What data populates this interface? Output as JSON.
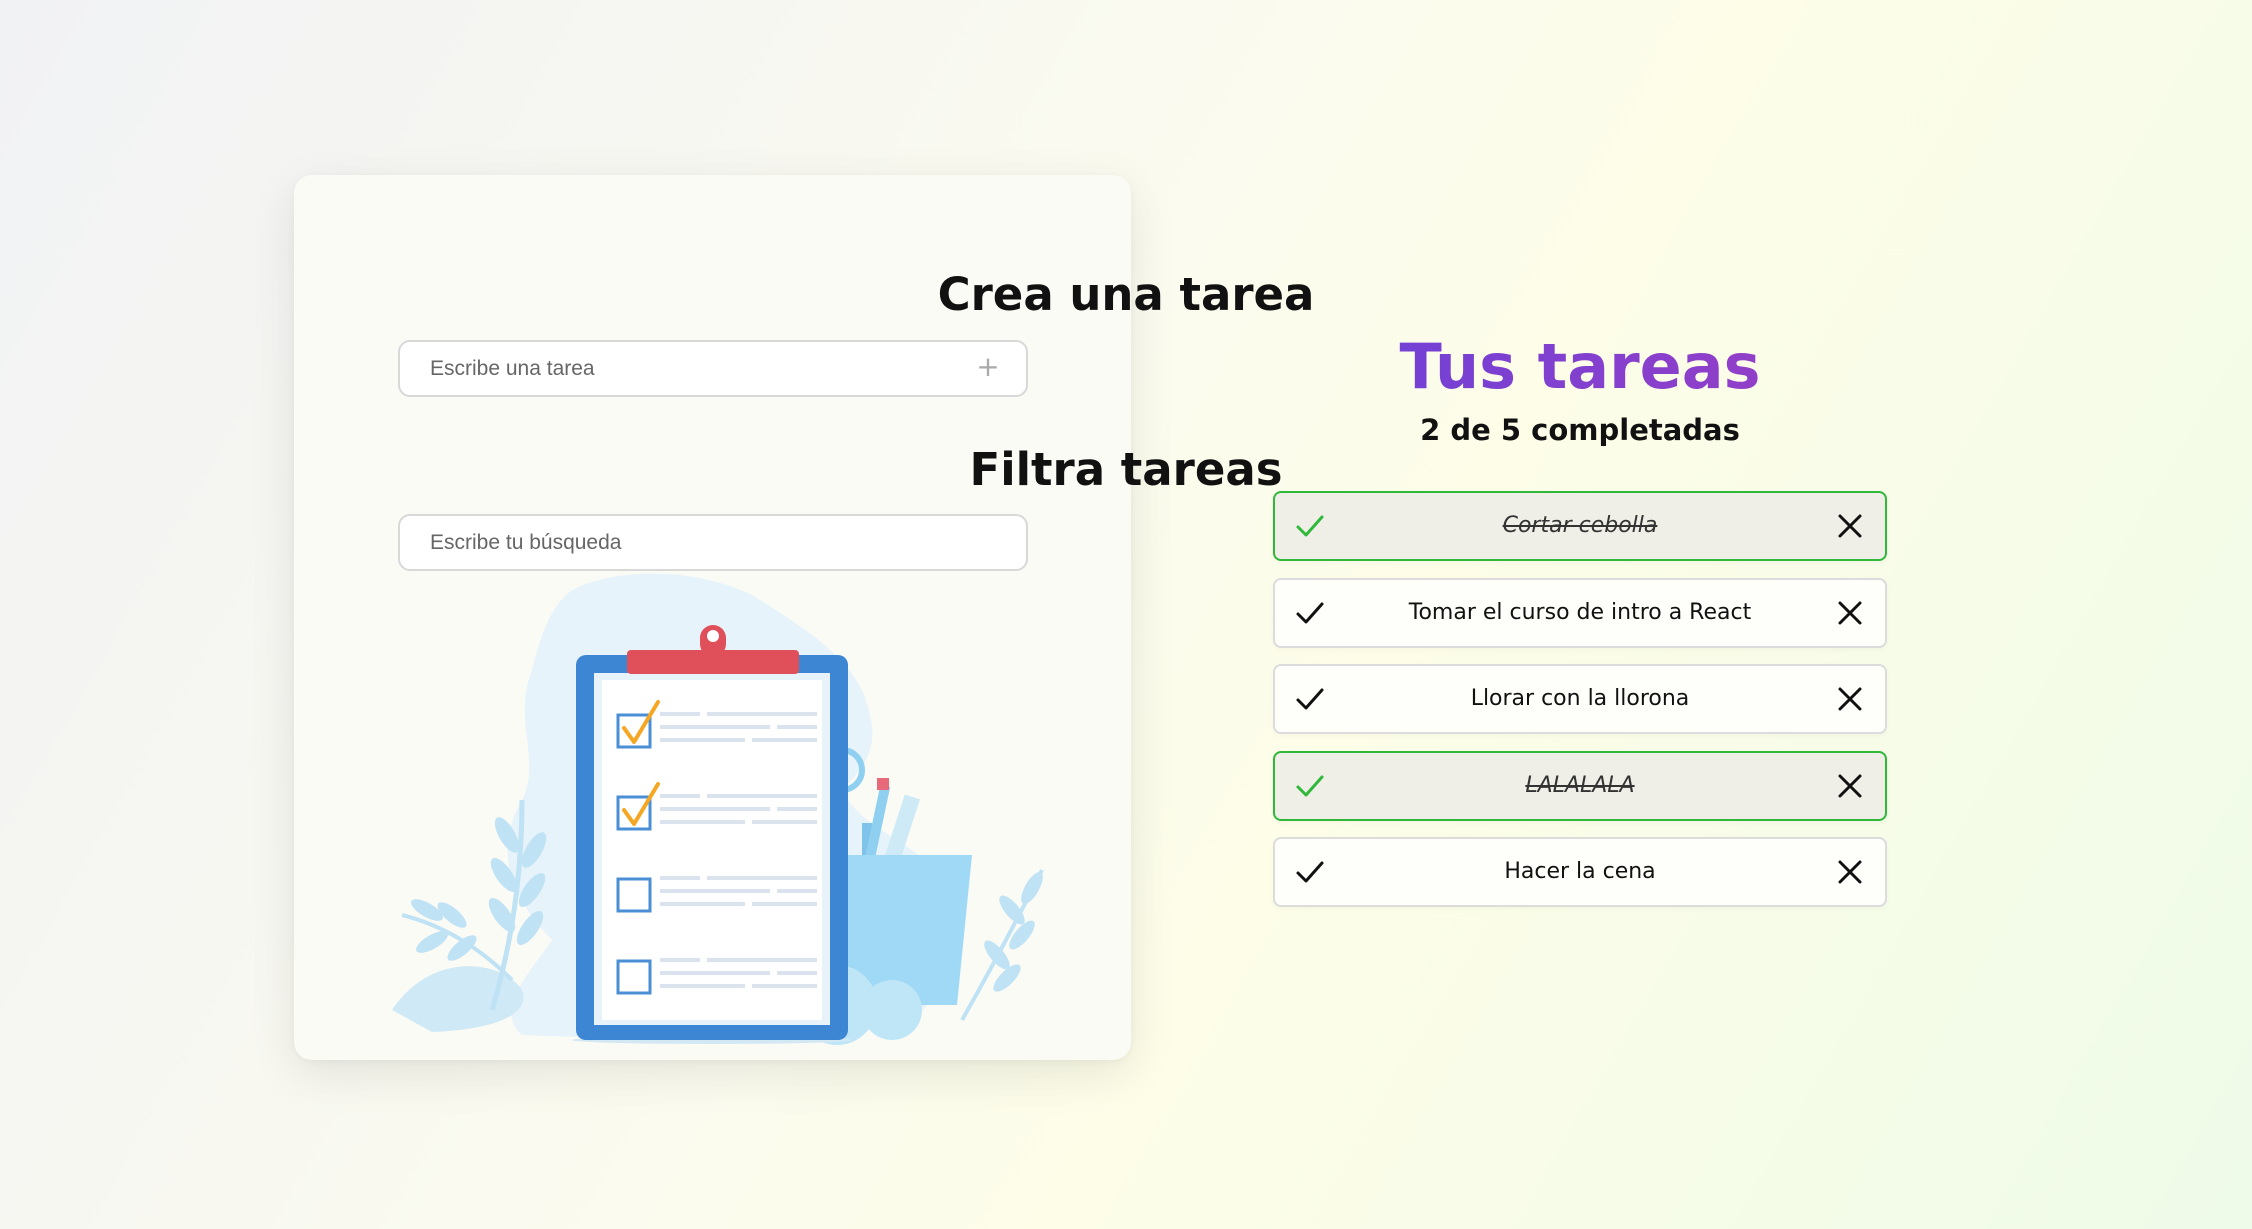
{
  "create_section": {
    "title": "Crea una tarea",
    "input_placeholder": "Escribe una tarea",
    "add_icon": "plus-icon"
  },
  "filter_section": {
    "title": "Filtra tareas",
    "input_placeholder": "Escribe tu búsqueda"
  },
  "illustration": {
    "icon": "clipboard-checklist-illustration"
  },
  "todo_panel": {
    "title": "Tus tareas",
    "counter": "2 de 5 completadas",
    "items": [
      {
        "text": "Cortar cebolla",
        "completed": true
      },
      {
        "text": "Tomar el curso de intro a React",
        "completed": false
      },
      {
        "text": "Llorar con la llorona",
        "completed": false
      },
      {
        "text": "LALALALA",
        "completed": true
      },
      {
        "text": "Hacer la cena",
        "completed": false
      }
    ]
  },
  "icons": {
    "check": "check-icon",
    "delete": "close-icon"
  },
  "colors": {
    "title_gradient_start": "#6a40d9",
    "title_gradient_end": "#9b3fc4",
    "completed_border": "#2fb83a",
    "completed_check": "#2fb83a",
    "checkbox_tick": "#f5a623",
    "clipboard_frame": "#3d86d4",
    "clipboard_clip": "#e0505a"
  }
}
